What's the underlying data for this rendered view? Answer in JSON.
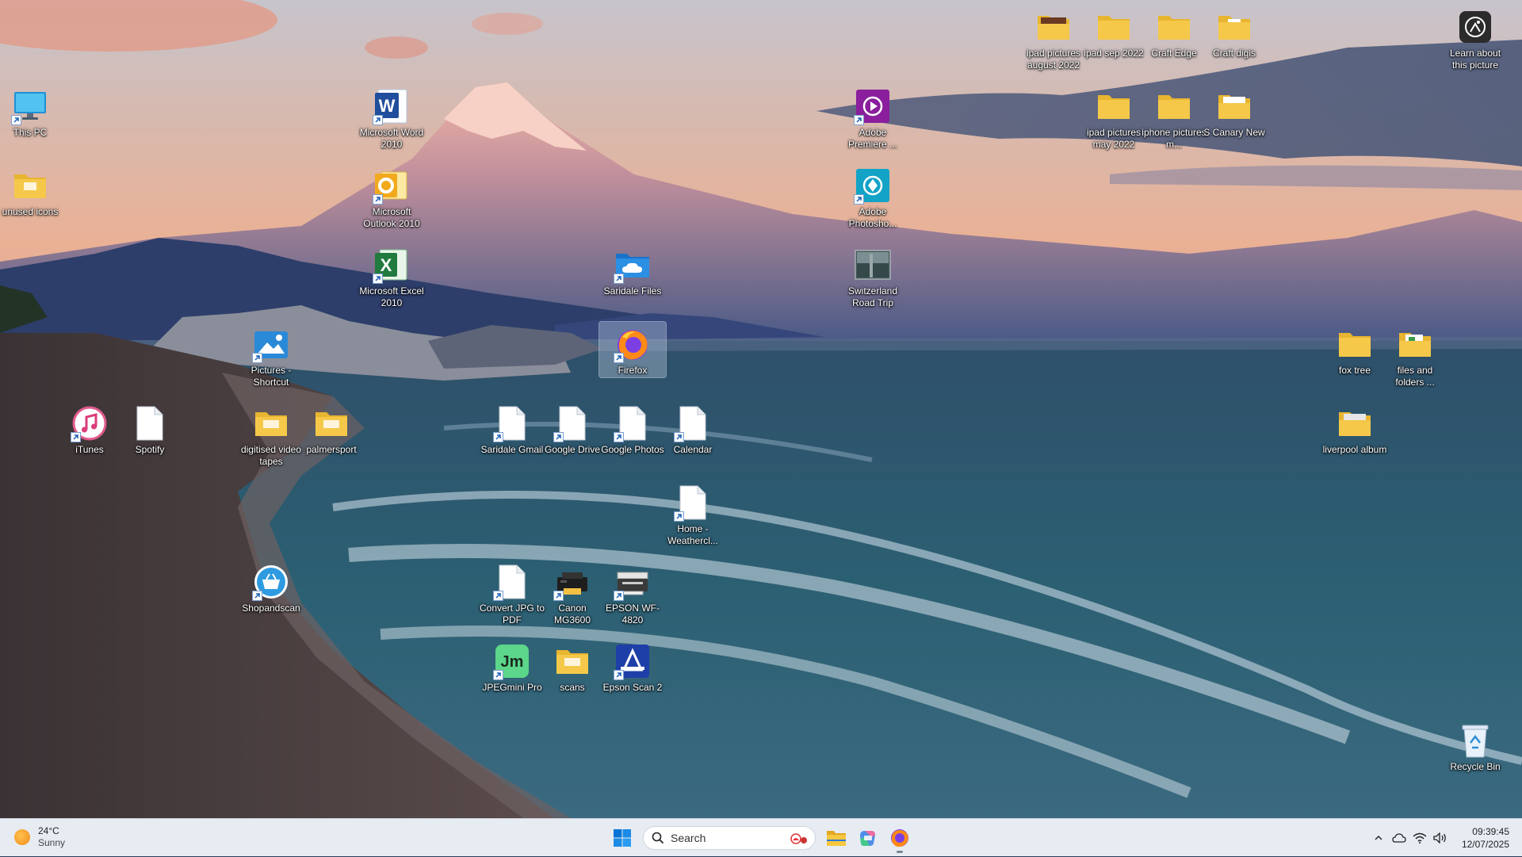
{
  "desktop": {
    "icons": [
      {
        "id": "this-pc",
        "label": "This PC"
      },
      {
        "id": "unused-icons",
        "label": "unused icons"
      },
      {
        "id": "word",
        "label": "Microsoft Word 2010"
      },
      {
        "id": "outlook",
        "label": "Microsoft Outlook 2010"
      },
      {
        "id": "excel",
        "label": "Microsoft Excel 2010"
      },
      {
        "id": "pictures-shortcut",
        "label": "Pictures - Shortcut"
      },
      {
        "id": "itunes",
        "label": "iTunes"
      },
      {
        "id": "spotify",
        "label": "Spotify"
      },
      {
        "id": "digitised-video-tapes",
        "label": "digitised video tapes"
      },
      {
        "id": "palmersport",
        "label": "palmersport"
      },
      {
        "id": "shopandscan",
        "label": "Shopandscan"
      },
      {
        "id": "saridale-files",
        "label": "Saridale Files"
      },
      {
        "id": "firefox",
        "label": "Firefox"
      },
      {
        "id": "saridale-gmail",
        "label": "Saridale Gmail"
      },
      {
        "id": "google-drive",
        "label": "Google Drive"
      },
      {
        "id": "google-photos",
        "label": "Google Photos"
      },
      {
        "id": "calendar",
        "label": "Calendar"
      },
      {
        "id": "home-weather",
        "label": "Home - Weathercl..."
      },
      {
        "id": "convert-jpg",
        "label": "Convert JPG to PDF"
      },
      {
        "id": "canon",
        "label": "Canon MG3600"
      },
      {
        "id": "epson-wf",
        "label": "EPSON WF-4820"
      },
      {
        "id": "jpegmini",
        "label": "JPEGmini Pro"
      },
      {
        "id": "scans",
        "label": "scans"
      },
      {
        "id": "epson-scan",
        "label": "Epson Scan 2"
      },
      {
        "id": "premiere",
        "label": "Adobe Premiere ..."
      },
      {
        "id": "photoshop",
        "label": "Adobe Photosho..."
      },
      {
        "id": "switzerland",
        "label": "Switzerland Road Trip"
      },
      {
        "id": "ipad-aug",
        "label": "ipad pictures august 2022"
      },
      {
        "id": "ipad-sep",
        "label": "ipad sep 2022"
      },
      {
        "id": "craft-edge",
        "label": "Craft Edge"
      },
      {
        "id": "craft-digis",
        "label": "Craft digis"
      },
      {
        "id": "ipad-may",
        "label": "ipad pictures may 2022"
      },
      {
        "id": "iphone-pics",
        "label": "iphone pictures m..."
      },
      {
        "id": "s-canary",
        "label": "S Canary New"
      },
      {
        "id": "learn-picture",
        "label": "Learn about this picture"
      },
      {
        "id": "fox-tree",
        "label": "fox tree"
      },
      {
        "id": "files-folders",
        "label": "files and folders ..."
      },
      {
        "id": "liverpool",
        "label": "liverpool album"
      },
      {
        "id": "recycle-bin",
        "label": "Recycle Bin"
      }
    ]
  },
  "taskbar": {
    "weather": {
      "temp": "24°C",
      "condition": "Sunny"
    },
    "search": {
      "placeholder": "Search"
    },
    "clock": {
      "time": "09:39:45",
      "date": "12/07/2025"
    },
    "pinned": [
      "windows-start-icon",
      "file-explorer-icon",
      "m365-copilot-icon",
      "firefox-icon"
    ],
    "tray": [
      "chevron-up-icon",
      "onedrive-icon",
      "wifi-icon",
      "speaker-icon"
    ]
  },
  "colors": {
    "taskbar_bg": "#e7ecf3",
    "folder": "#f5c84a",
    "accent": "#0067c0"
  }
}
